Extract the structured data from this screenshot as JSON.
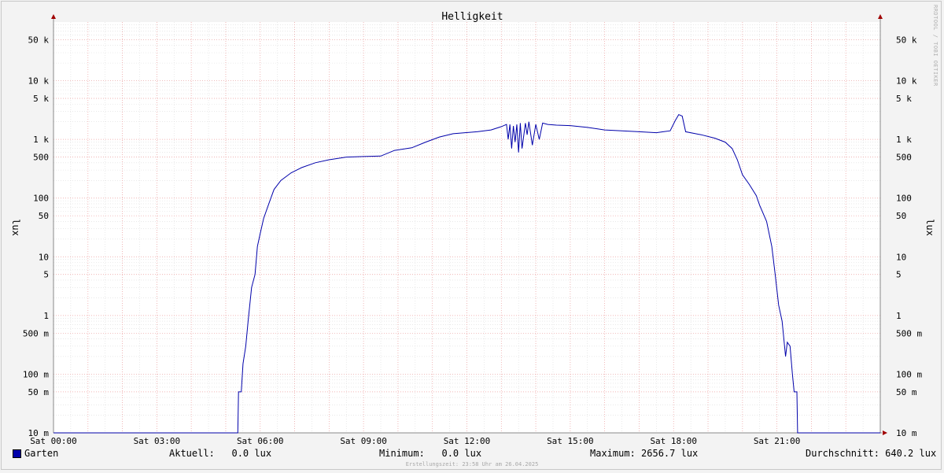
{
  "chart_data": {
    "type": "line",
    "title": "Helligkeit",
    "ylabel": "lux",
    "y_scale": "log",
    "ylim": [
      0.01,
      100000
    ],
    "xlim_hours": [
      0,
      24
    ],
    "y_ticks": [
      {
        "value": 0.01,
        "label": "10 m"
      },
      {
        "value": 0.05,
        "label": "50 m"
      },
      {
        "value": 0.1,
        "label": "100 m"
      },
      {
        "value": 0.5,
        "label": "500 m"
      },
      {
        "value": 1,
        "label": "1"
      },
      {
        "value": 5,
        "label": "5"
      },
      {
        "value": 10,
        "label": "10"
      },
      {
        "value": 50,
        "label": "50"
      },
      {
        "value": 100,
        "label": "100"
      },
      {
        "value": 500,
        "label": "500"
      },
      {
        "value": 1000,
        "label": "1 k"
      },
      {
        "value": 5000,
        "label": "5 k"
      },
      {
        "value": 10000,
        "label": "10 k"
      },
      {
        "value": 50000,
        "label": "50 k"
      }
    ],
    "x_ticks": [
      {
        "value": 0,
        "label": "Sat 00:00"
      },
      {
        "value": 3,
        "label": "Sat 03:00"
      },
      {
        "value": 6,
        "label": "Sat 06:00"
      },
      {
        "value": 9,
        "label": "Sat 09:00"
      },
      {
        "value": 12,
        "label": "Sat 12:00"
      },
      {
        "value": 15,
        "label": "Sat 15:00"
      },
      {
        "value": 18,
        "label": "Sat 18:00"
      },
      {
        "value": 21,
        "label": "Sat 21:00"
      }
    ],
    "grid": true,
    "series": [
      {
        "name": "Garten",
        "color": "#0000aa",
        "points": [
          [
            0.0,
            0.01
          ],
          [
            5.35,
            0.01
          ],
          [
            5.37,
            0.05
          ],
          [
            5.45,
            0.05
          ],
          [
            5.5,
            0.15
          ],
          [
            5.58,
            0.3
          ],
          [
            5.65,
            0.8
          ],
          [
            5.75,
            3
          ],
          [
            5.85,
            5
          ],
          [
            5.92,
            15
          ],
          [
            6.0,
            25
          ],
          [
            6.1,
            45
          ],
          [
            6.25,
            80
          ],
          [
            6.4,
            140
          ],
          [
            6.6,
            200
          ],
          [
            6.9,
            270
          ],
          [
            7.2,
            330
          ],
          [
            7.6,
            400
          ],
          [
            8.0,
            450
          ],
          [
            8.5,
            500
          ],
          [
            9.0,
            510
          ],
          [
            9.5,
            520
          ],
          [
            9.9,
            650
          ],
          [
            10.4,
            720
          ],
          [
            10.8,
            900
          ],
          [
            11.2,
            1100
          ],
          [
            11.6,
            1250
          ],
          [
            12.3,
            1350
          ],
          [
            12.7,
            1450
          ],
          [
            13.0,
            1650
          ],
          [
            13.15,
            1800
          ],
          [
            13.2,
            1000
          ],
          [
            13.25,
            1800
          ],
          [
            13.3,
            700
          ],
          [
            13.35,
            1700
          ],
          [
            13.4,
            900
          ],
          [
            13.45,
            1800
          ],
          [
            13.5,
            600
          ],
          [
            13.55,
            1900
          ],
          [
            13.6,
            700
          ],
          [
            13.7,
            1900
          ],
          [
            13.75,
            1200
          ],
          [
            13.8,
            2000
          ],
          [
            13.9,
            800
          ],
          [
            14.0,
            1800
          ],
          [
            14.1,
            1000
          ],
          [
            14.2,
            1900
          ],
          [
            14.35,
            1800
          ],
          [
            14.6,
            1750
          ],
          [
            15.0,
            1720
          ],
          [
            15.5,
            1600
          ],
          [
            16.0,
            1450
          ],
          [
            16.5,
            1400
          ],
          [
            17.0,
            1350
          ],
          [
            17.5,
            1300
          ],
          [
            17.7,
            1350
          ],
          [
            17.9,
            1400
          ],
          [
            18.05,
            2100
          ],
          [
            18.15,
            2650
          ],
          [
            18.25,
            2500
          ],
          [
            18.35,
            1350
          ],
          [
            18.8,
            1200
          ],
          [
            19.2,
            1050
          ],
          [
            19.5,
            900
          ],
          [
            19.7,
            700
          ],
          [
            19.85,
            450
          ],
          [
            20.0,
            250
          ],
          [
            20.2,
            170
          ],
          [
            20.4,
            110
          ],
          [
            20.5,
            75
          ],
          [
            20.7,
            40
          ],
          [
            20.85,
            15
          ],
          [
            20.95,
            5
          ],
          [
            21.05,
            1.5
          ],
          [
            21.15,
            0.8
          ],
          [
            21.2,
            0.4
          ],
          [
            21.25,
            0.2
          ],
          [
            21.3,
            0.35
          ],
          [
            21.38,
            0.3
          ],
          [
            21.45,
            0.1
          ],
          [
            21.5,
            0.05
          ],
          [
            21.58,
            0.05
          ],
          [
            21.6,
            0.01
          ],
          [
            24.0,
            0.01
          ]
        ]
      }
    ]
  },
  "legend": {
    "name": "Garten",
    "color": "#0000aa",
    "aktuell": "Aktuell:   0.0 lux",
    "minimum": "Minimum:   0.0 lux",
    "maximum": "Maximum: 2656.7 lux",
    "durchschnitt": "Durchschnitt: 640.2 lux"
  },
  "footer": "Erstellungszeit: 23:58 Uhr am 26.04.2025",
  "watermark": "RRDTOOL / TOBI OETIKER"
}
